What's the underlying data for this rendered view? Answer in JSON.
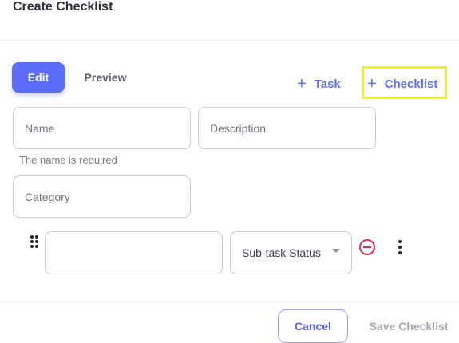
{
  "dialog": {
    "title": "Create Checklist"
  },
  "tabs": {
    "edit_label": "Edit",
    "preview_label": "Preview"
  },
  "actions": {
    "add_task_label": "Task",
    "add_checklist_label": "Checklist",
    "plus_icon": "+"
  },
  "form": {
    "name_placeholder": "Name",
    "name_error": "The name is required",
    "description_placeholder": "Description",
    "category_placeholder": "Category"
  },
  "subtask": {
    "status_select": "Sub-task Status"
  },
  "footer": {
    "cancel_label": "Cancel",
    "save_label": "Save Checklist"
  },
  "colors": {
    "accent": "#5b6cf9",
    "danger": "#e0314f",
    "highlight": "#f5f50a"
  }
}
